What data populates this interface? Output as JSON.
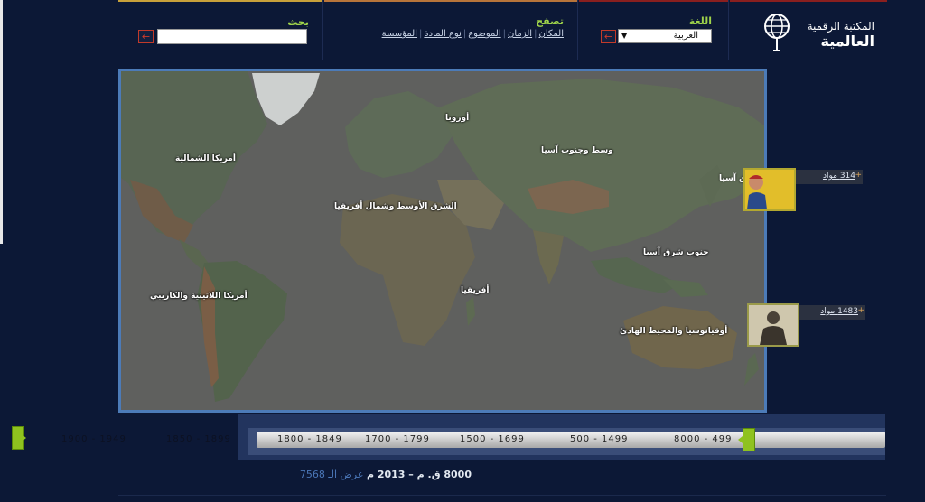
{
  "header": {
    "search": {
      "label": "بحث",
      "placeholder": "",
      "go": "←"
    },
    "browse": {
      "label": "تصفح",
      "links": [
        "المكان",
        "الزمان",
        "الموضوع",
        "نوع المادة",
        "المؤسسة"
      ]
    },
    "language": {
      "label": "اللغة",
      "selected": "العربية",
      "go": "←"
    },
    "logo": {
      "line1": "المكتبة الرقمية",
      "line2": "العالمية"
    }
  },
  "map": {
    "regions": [
      {
        "id": "north-america",
        "label": "أمريكا الشمالية"
      },
      {
        "id": "europe",
        "label": "أوروبا"
      },
      {
        "id": "central-south-asia",
        "label": "وسط وجنوب آسيا"
      },
      {
        "id": "middle-east",
        "label": "الشرق الأوسط وشمال أفريقيا"
      },
      {
        "id": "southeast-asia",
        "label": "جنوب شرق آسيا"
      },
      {
        "id": "africa",
        "label": "أفريقيا"
      },
      {
        "id": "latin-america",
        "label": "أمريكا اللاتينية والكاريبي"
      },
      {
        "id": "oceania",
        "label": "أوقيانوسيا والمحيط الهادئ"
      }
    ]
  },
  "side": {
    "east_asia": {
      "region": "شرق آسيا",
      "count": "314 مواد"
    },
    "oceania": {
      "count": "1483 مواد"
    }
  },
  "timeline": {
    "periods": [
      "8000 - 499",
      "500 - 1499",
      "1500 - 1699",
      "1700 - 1799",
      "1800 - 1849"
    ],
    "offscreen_periods": [
      "1850 - 1899",
      "1900 - 1949"
    ]
  },
  "range": {
    "text": "8000 ق. م – 2013 م",
    "count_link": "عرض الـ 7568"
  },
  "colors": {
    "accent_green": "#8fc21f",
    "label_green": "#9fd34a",
    "bg": "#0c1836",
    "map_border": "#4c7bb8"
  }
}
